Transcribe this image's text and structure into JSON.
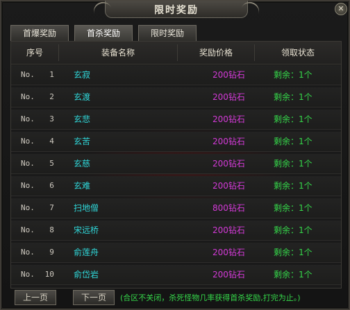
{
  "window": {
    "title": "限时奖励",
    "close_icon": "close-icon"
  },
  "tabs": [
    {
      "label": "首爆奖励",
      "active": false
    },
    {
      "label": "首杀奖励",
      "active": true
    },
    {
      "label": "限时奖励",
      "active": false
    }
  ],
  "table": {
    "headers": {
      "no": "序号",
      "name": "装备名称",
      "price": "奖励价格",
      "status": "领取状态"
    },
    "rows": [
      {
        "no_label": "No.",
        "no": "1",
        "name": "玄寂",
        "price": "200钻石",
        "status": "剩余：1个"
      },
      {
        "no_label": "No.",
        "no": "2",
        "name": "玄渡",
        "price": "200钻石",
        "status": "剩余：1个"
      },
      {
        "no_label": "No.",
        "no": "3",
        "name": "玄悲",
        "price": "200钻石",
        "status": "剩余：1个"
      },
      {
        "no_label": "No.",
        "no": "4",
        "name": "玄苦",
        "price": "200钻石",
        "status": "剩余：1个"
      },
      {
        "no_label": "No.",
        "no": "5",
        "name": "玄慈",
        "price": "200钻石",
        "status": "剩余：1个"
      },
      {
        "no_label": "No.",
        "no": "6",
        "name": "玄难",
        "price": "200钻石",
        "status": "剩余：1个"
      },
      {
        "no_label": "No.",
        "no": "7",
        "name": "扫地僧",
        "price": "800钻石",
        "status": "剩余：1个"
      },
      {
        "no_label": "No.",
        "no": "8",
        "name": "宋远桥",
        "price": "200钻石",
        "status": "剩余：1个"
      },
      {
        "no_label": "No.",
        "no": "9",
        "name": "俞莲舟",
        "price": "200钻石",
        "status": "剩余：1个"
      },
      {
        "no_label": "No.",
        "no": "10",
        "name": "俞岱岩",
        "price": "200钻石",
        "status": "剩余：1个"
      }
    ]
  },
  "footer": {
    "prev_label": "上一页",
    "next_label": "下一页",
    "note": "(合区不关闭，杀死怪物几率获得首杀奖励,打完为止。)"
  },
  "colors": {
    "name": "#2fd6d8",
    "price": "#d43ad8",
    "status": "#35d84a"
  }
}
